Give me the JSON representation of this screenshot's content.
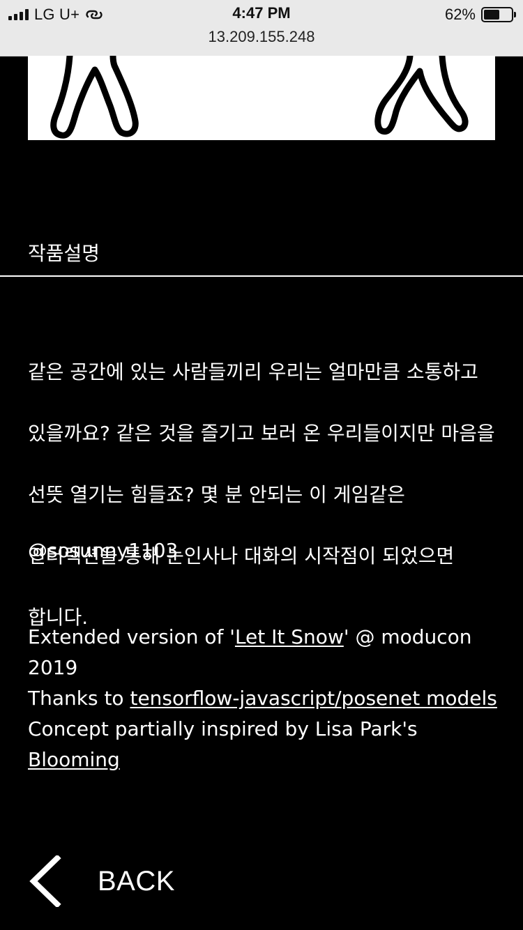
{
  "status_bar": {
    "carrier": "LG U+",
    "time": "4:47 PM",
    "battery": "62%",
    "battery_level": 0.62,
    "address": "13.209.155.248",
    "icons": [
      "signal-icon",
      "link-icon",
      "battery-icon"
    ]
  },
  "artwork": {
    "icon": "figure-legs-illustration"
  },
  "section": {
    "title": "작품설명"
  },
  "description": {
    "lines": [
      "같은 공간에 있는 사람들끼리 우리는 얼마만큼 소통하고",
      "있을까요? 같은 것을 즐기고 보러 온 우리들이지만 마음을",
      "선뜻 열기는 힘들죠? 몇 분 안되는 이 게임같은",
      "인터렉션을 통해 눈인사나 대화의 시작점이 되었으면",
      "합니다."
    ]
  },
  "author": {
    "handle": "@sosunny1103"
  },
  "credits": {
    "line1_prefix": "Extended version of '",
    "line1_link": "Let It Snow",
    "line1_suffix": "' @ moducon 2019",
    "line2_prefix": "Thanks to ",
    "line2_link": "tensorflow-javascript/posenet models ",
    "line3_prefix": "Concept partially inspired by Lisa Park's ",
    "line3_link": "Blooming"
  },
  "nav": {
    "back_label": "BACK",
    "back_icon": "chevron-left-icon"
  },
  "colors": {
    "background": "#000000",
    "text": "#ffffff",
    "status_bar": "#e9e9e9"
  }
}
